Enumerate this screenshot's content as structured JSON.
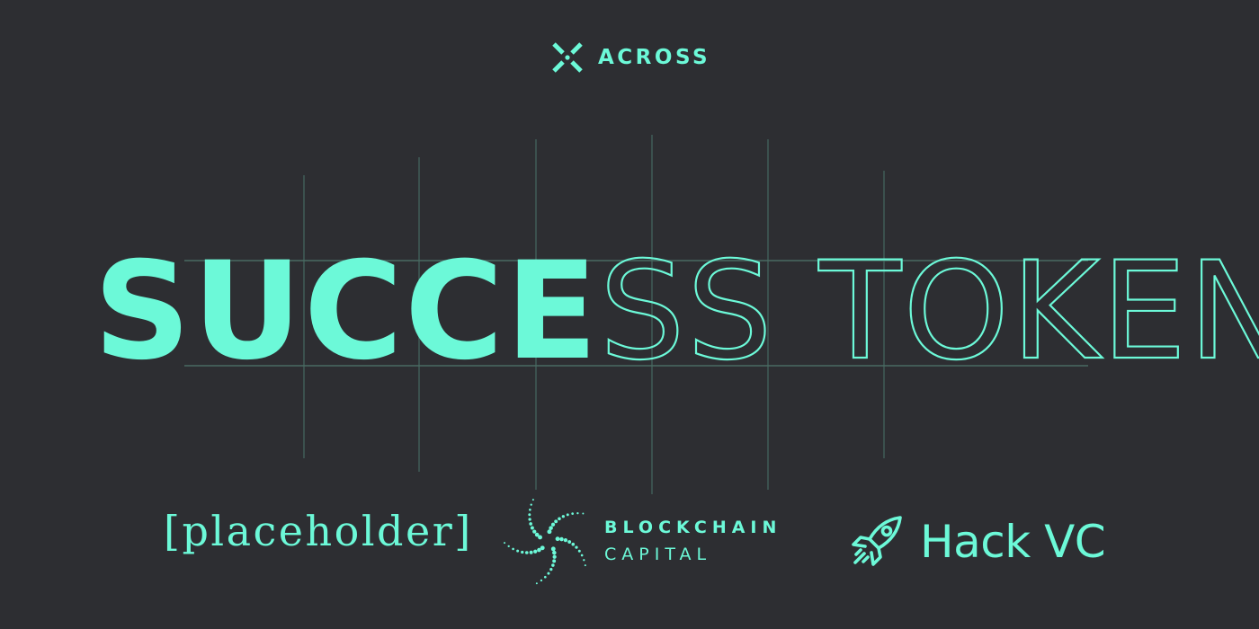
{
  "brand": {
    "name": "ACROSS",
    "icon": "x-cross-icon"
  },
  "headline": {
    "solid": "SUCCE",
    "outline": "SS TOKENS"
  },
  "partners": {
    "placeholder": "[placeholder]",
    "blockchain_line1": "BLOCKCHAIN",
    "blockchain_line2": "CAPITAL",
    "blockchain_icon": "starburst-dots-icon",
    "hack": "Hack VC",
    "hack_icon": "rocket-icon"
  },
  "colors": {
    "background": "#2d2e32",
    "accent": "#6cf9d8",
    "grid": "#3f5a55"
  }
}
